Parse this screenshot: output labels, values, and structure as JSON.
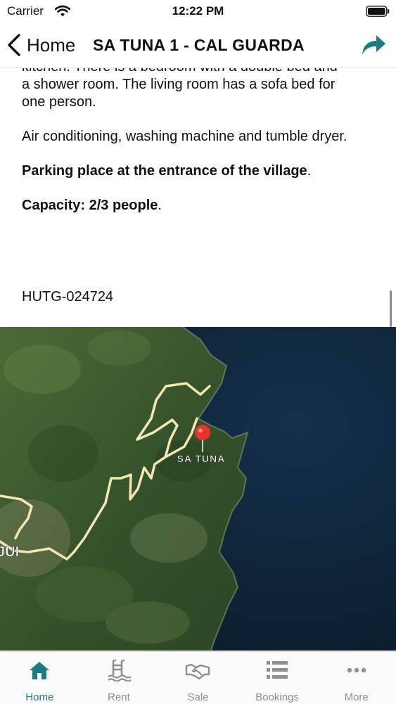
{
  "status_bar": {
    "carrier": "Carrier",
    "time": "12:22 PM"
  },
  "nav": {
    "back_label": "Home",
    "title": "SA TUNA 1 - CAL GUARDA"
  },
  "description": {
    "line_partial": "kitchen. There is a bedroom with a double bed and",
    "line_2": "a shower room. The living room has a sofa bed for",
    "line_3": "one person.",
    "amenities": "Air conditioning, washing machine and tumble dryer.",
    "parking_bold": "Parking place at the entrance of the village",
    "parking_end": ".",
    "capacity_bold": "Capacity: 2/3 people",
    "capacity_end": ".",
    "license": "HUTG-024724"
  },
  "map": {
    "marker_label": "SA TUNA",
    "left_partial_label": "JUI"
  },
  "tabs": [
    {
      "label": "Home",
      "icon": "home-icon",
      "active": true
    },
    {
      "label": "Rent",
      "icon": "pool-icon",
      "active": false
    },
    {
      "label": "Sale",
      "icon": "handshake-icon",
      "active": false
    },
    {
      "label": "Bookings",
      "icon": "list-icon",
      "active": false
    },
    {
      "label": "More",
      "icon": "more-icon",
      "active": false
    }
  ],
  "colors": {
    "accent": "#1b7c86",
    "inactive": "#8e8e93",
    "marker": "#e8322f",
    "sea": "#0e2436",
    "land": "#3c5a2a"
  }
}
